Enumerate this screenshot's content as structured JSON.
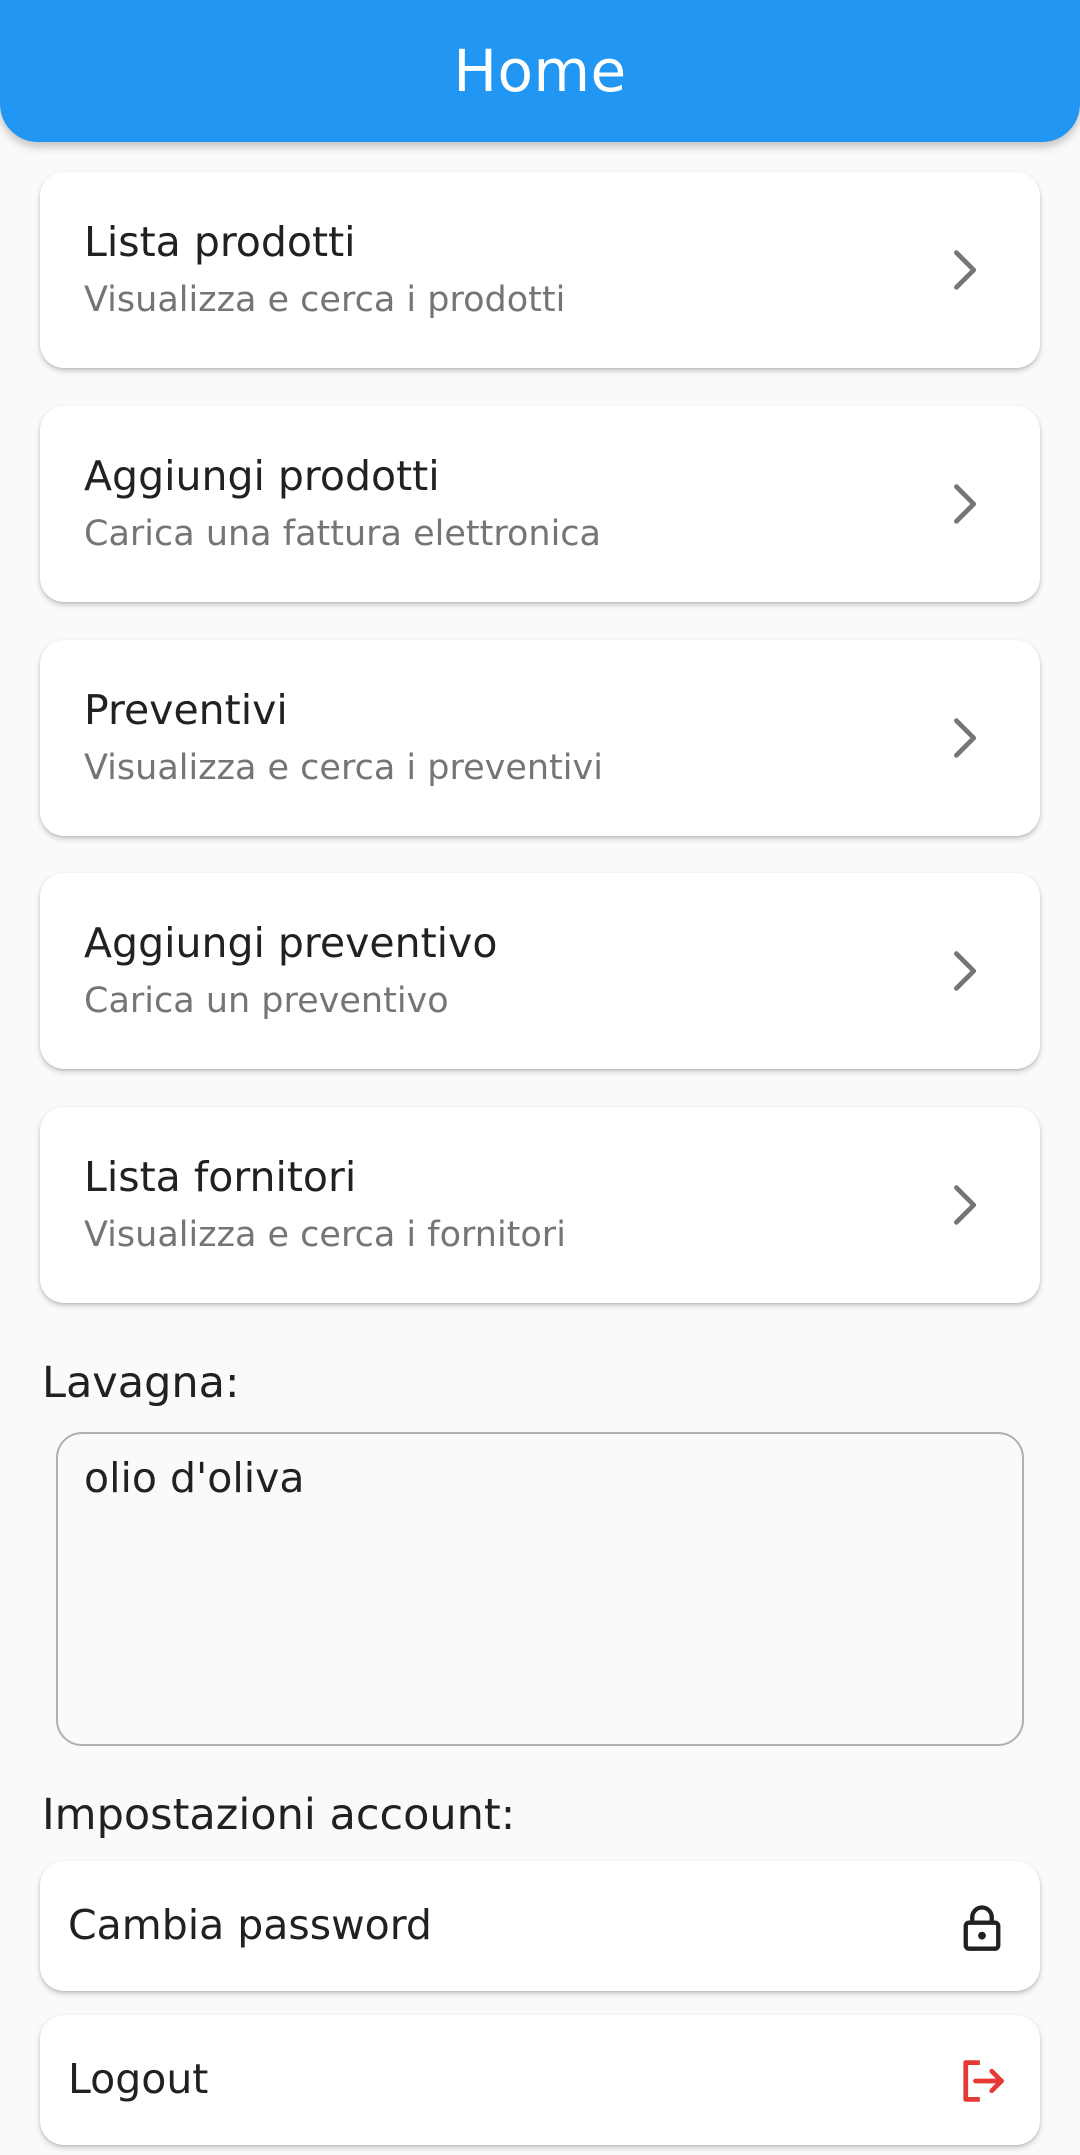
{
  "appbar": {
    "title": "Home"
  },
  "menu": {
    "items": [
      {
        "title": "Lista prodotti",
        "subtitle": "Visualizza e cerca i prodotti"
      },
      {
        "title": "Aggiungi prodotti",
        "subtitle": "Carica una fattura elettronica"
      },
      {
        "title": "Preventivi",
        "subtitle": "Visualizza e cerca i preventivi"
      },
      {
        "title": "Aggiungi preventivo",
        "subtitle": "Carica un preventivo"
      },
      {
        "title": "Lista fornitori",
        "subtitle": "Visualizza e cerca i fornitori"
      }
    ]
  },
  "board": {
    "label": "Lavagna:",
    "value": "olio d'oliva"
  },
  "account": {
    "label": "Impostazioni account:",
    "change_password": "Cambia password",
    "logout": "Logout"
  },
  "icons": {
    "chevron": "chevron-right-icon",
    "password": "lock-icon",
    "logout": "logout-icon"
  },
  "colors": {
    "primary": "#2196f3",
    "logout": "#e53935",
    "chevron": "#757575"
  }
}
